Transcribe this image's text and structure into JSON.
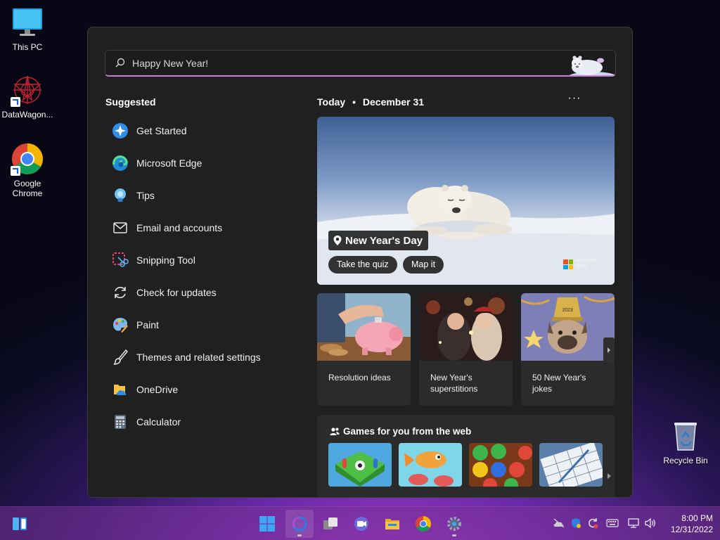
{
  "desktop": {
    "icons": [
      {
        "label": "This PC"
      },
      {
        "label": "DataWagon..."
      },
      {
        "label": "Google Chrome"
      },
      {
        "label": "Recycle Bin"
      }
    ]
  },
  "search": {
    "value": "Happy New Year!",
    "placeholder": "Happy New Year!"
  },
  "suggested": {
    "title": "Suggested",
    "items": [
      {
        "label": "Get Started",
        "icon": "get-started-icon"
      },
      {
        "label": "Microsoft Edge",
        "icon": "edge-icon"
      },
      {
        "label": "Tips",
        "icon": "tips-icon"
      },
      {
        "label": "Email and accounts",
        "icon": "mail-icon"
      },
      {
        "label": "Snipping Tool",
        "icon": "snipping-tool-icon"
      },
      {
        "label": "Check for updates",
        "icon": "refresh-icon"
      },
      {
        "label": "Paint",
        "icon": "paint-icon"
      },
      {
        "label": "Themes and related settings",
        "icon": "brush-icon"
      },
      {
        "label": "OneDrive",
        "icon": "onedrive-icon"
      },
      {
        "label": "Calculator",
        "icon": "calculator-icon"
      }
    ]
  },
  "today": {
    "label": "Today",
    "separator": "•",
    "date": "December 31",
    "more": "···",
    "hero": {
      "title": "New Year's Day",
      "buttons": [
        "Take the quiz",
        "Map it"
      ],
      "brand_line1": "Microsoft",
      "brand_line2": "Bing"
    },
    "cards": [
      {
        "caption": "Resolution ideas"
      },
      {
        "caption": "New Year's superstitions"
      },
      {
        "caption": "50 New Year's jokes"
      }
    ],
    "games": {
      "title": "Games for you from the web"
    }
  },
  "taskbar": {
    "time": "8:00 PM",
    "date": "12/31/2022"
  },
  "colors": {
    "accent": "#c77fd6",
    "panel": "#202020",
    "card": "#2b2b2b"
  }
}
